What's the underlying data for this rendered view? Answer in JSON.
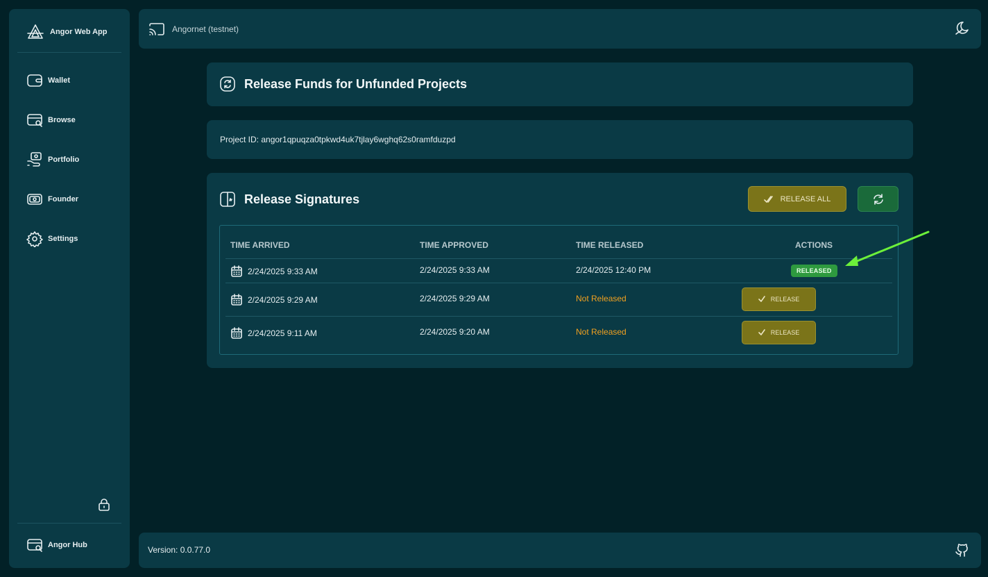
{
  "app": {
    "name": "Angor Web App"
  },
  "sidebar": {
    "items": [
      {
        "label": "Wallet",
        "icon": "wallet-icon"
      },
      {
        "label": "Browse",
        "icon": "browse-icon"
      },
      {
        "label": "Portfolio",
        "icon": "portfolio-icon"
      },
      {
        "label": "Founder",
        "icon": "founder-icon"
      },
      {
        "label": "Settings",
        "icon": "gear-icon"
      }
    ],
    "lock_icon": "lock-icon",
    "hub": {
      "label": "Angor Hub",
      "icon": "hub-icon"
    }
  },
  "topbar": {
    "network": "Angornet (testnet)",
    "theme_icon": "theme-toggle-icon"
  },
  "page": {
    "title": "Release Funds for Unfunded Projects",
    "project_id": "Project ID: angor1qpuqza0tpkwd4uk7tjlay6wghq62s0ramfduzpd"
  },
  "signatures": {
    "title": "Release Signatures",
    "release_all_label": "RELEASE ALL",
    "columns": [
      "TIME ARRIVED",
      "TIME APPROVED",
      "TIME RELEASED",
      "ACTIONS"
    ],
    "rows": [
      {
        "arrived": "2/24/2025 9:33 AM",
        "approved": "2/24/2025 9:33 AM",
        "released": "2/24/2025 12:40 PM",
        "action": "RELEASED"
      },
      {
        "arrived": "2/24/2025 9:29 AM",
        "approved": "2/24/2025 9:29 AM",
        "released": "Not Released",
        "action": "RELEASE"
      },
      {
        "arrived": "2/24/2025 9:11 AM",
        "approved": "2/24/2025 9:20 AM",
        "released": "Not Released",
        "action": "RELEASE"
      }
    ]
  },
  "footer": {
    "version": "Version: 0.0.77.0"
  },
  "colors": {
    "background": "#022127",
    "panel": "#0a3a45",
    "release_button": "#7b7419",
    "released_badge": "#2e9a3f",
    "not_released_text": "#f0a020",
    "annotation_arrow": "#6cf03a"
  }
}
